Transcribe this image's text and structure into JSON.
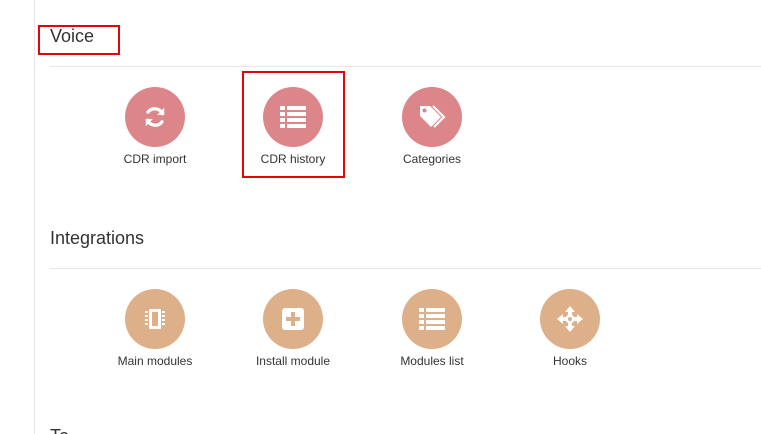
{
  "colors": {
    "voice_icon_bg": "#dc868a",
    "integrations_icon_bg": "#ddb08a",
    "highlight_border": "#e2050b"
  },
  "sections": {
    "voice": {
      "title": "Voice",
      "items": [
        {
          "label": "CDR import",
          "icon": "sync-icon"
        },
        {
          "label": "CDR history",
          "icon": "list-icon"
        },
        {
          "label": "Categories",
          "icon": "tags-icon"
        }
      ]
    },
    "integrations": {
      "title": "Integrations",
      "items": [
        {
          "label": "Main modules",
          "icon": "chip-icon"
        },
        {
          "label": "Install module",
          "icon": "plus-square-icon"
        },
        {
          "label": "Modules list",
          "icon": "list-icon"
        },
        {
          "label": "Hooks",
          "icon": "arrows-move-icon"
        }
      ]
    },
    "next_section_partial": {
      "title": "To"
    }
  }
}
